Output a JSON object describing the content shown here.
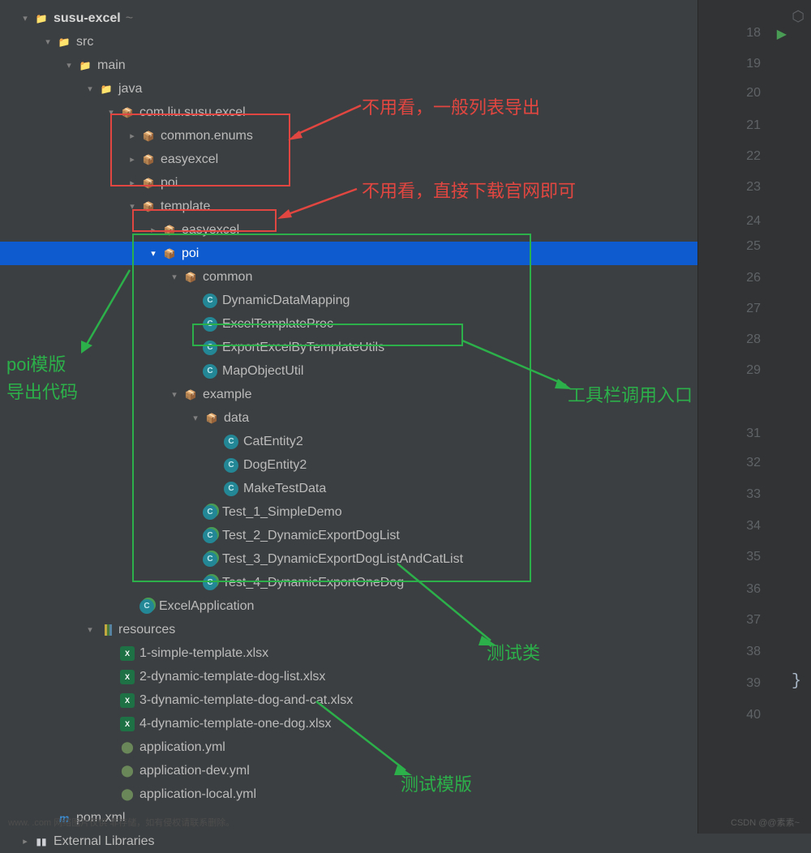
{
  "tree": {
    "root": "susu-excel",
    "rootSuffix": "~",
    "src": "src",
    "main": "main",
    "java": "java",
    "pkg": "com.liu.susu.excel",
    "commonEnums": "common.enums",
    "easyexcel1": "easyexcel",
    "poi1": "poi",
    "template": "template",
    "easyexcel2": "easyexcel",
    "poi2": "poi",
    "common": "common",
    "DynamicDataMapping": "DynamicDataMapping",
    "ExcelTemplateProc": "ExcelTemplateProc",
    "ExportExcelByTemplateUtils": "ExportExcelByTemplateUtils",
    "MapObjectUtil": "MapObjectUtil",
    "example": "example",
    "data": "data",
    "CatEntity2": "CatEntity2",
    "DogEntity2": "DogEntity2",
    "MakeTestData": "MakeTestData",
    "Test1": "Test_1_SimpleDemo",
    "Test2": "Test_2_DynamicExportDogList",
    "Test3": "Test_3_DynamicExportDogListAndCatList",
    "Test4": "Test_4_DynamicExportOneDog",
    "ExcelApplication": "ExcelApplication",
    "resources": "resources",
    "x1": "1-simple-template.xlsx",
    "x2": "2-dynamic-template-dog-list.xlsx",
    "x3": "3-dynamic-template-dog-and-cat.xlsx",
    "x4": "4-dynamic-template-one-dog.xlsx",
    "y1": "application.yml",
    "y2": "application-dev.yml",
    "y3": "application-local.yml",
    "pom": "pom.xml",
    "extLib": "External Libraries"
  },
  "gutter": [
    "18",
    "19",
    "20",
    "21",
    "22",
    "23",
    "24",
    "25",
    "26",
    "27",
    "28",
    "29",
    "31",
    "32",
    "33",
    "34",
    "35",
    "36",
    "37",
    "38",
    "39",
    "40"
  ],
  "annotations": {
    "red1": "不用看，一般列表导出",
    "red2": "不用看，直接下载官网即可",
    "green1a": "poi模版",
    "green1b": "导出代码",
    "green2": "工具栏调用入口",
    "green3": "测试类",
    "green4": "测试模版"
  },
  "watermark": "CSDN @@素素~",
  "watermark2": "www.   .com 网络图片仅供    非存储，如有侵权请联系删除。"
}
